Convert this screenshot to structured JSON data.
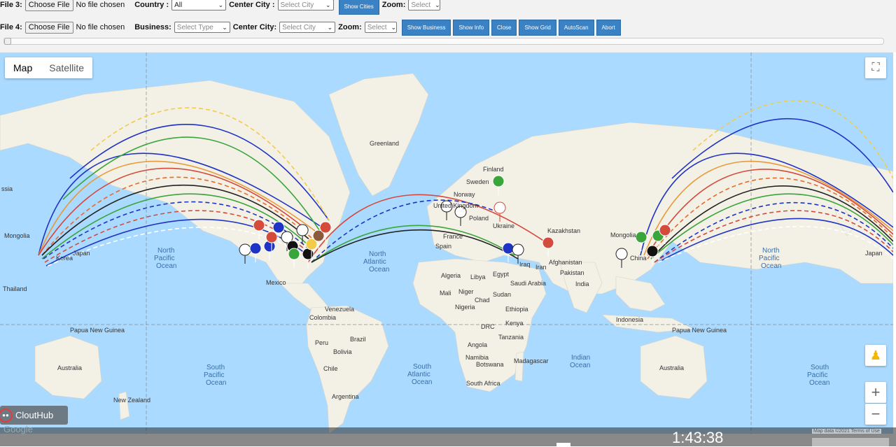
{
  "toolbar": {
    "row1": {
      "file_label": "File 3:",
      "choose_file": "Choose File",
      "no_file": "No file chosen",
      "country_label": "Country :",
      "country_value": "All",
      "center_city_label": "Center City :",
      "center_city_value": "Select City",
      "show_cities": "Show Cities",
      "zoom_label": "Zoom:",
      "zoom_value": "Select"
    },
    "row2": {
      "file_label": "File 4:",
      "choose_file": "Choose File",
      "no_file": "No file chosen",
      "business_label": "Business:",
      "business_value": "Select Type",
      "center_city_label": "Center City:",
      "center_city_value": "Select City",
      "zoom_label": "Zoom:",
      "zoom_value": "Select",
      "buttons": [
        "Show Business",
        "Show Info",
        "Close",
        "Show Grid",
        "AutoScan",
        "Abort"
      ]
    }
  },
  "map": {
    "type_map": "Map",
    "type_satellite": "Satellite",
    "labels": {
      "greenland": "Greenland",
      "finland": "Finland",
      "sweden": "Sweden",
      "norway": "Norway",
      "kazakhstan": "Kazakhstan",
      "mongolia_r": "Mongolia",
      "mongolia_l": "Mongolia",
      "japan_l": "Japan",
      "korea_l": "Korea",
      "thailand": "Thailand",
      "japan_r": "Japan",
      "china": "China",
      "india": "India",
      "iran": "Iran",
      "iraq": "Iraq",
      "afghanistan": "Afghanistan",
      "pakistan": "Pakistan",
      "mexico": "Mexico",
      "venezuela": "Venezuela",
      "colombia": "Colombia",
      "peru": "Peru",
      "bolivia": "Bolivia",
      "brazil": "Brazil",
      "chile": "Chile",
      "argentina": "Argentina",
      "algeria": "Algeria",
      "libya": "Libya",
      "egypt": "Egypt",
      "mali": "Mali",
      "niger": "Niger",
      "chad": "Chad",
      "sudan": "Sudan",
      "nigeria": "Nigeria",
      "ethiopia": "Ethiopia",
      "kenya": "Kenya",
      "drc": "DRC",
      "tanzania": "Tanzania",
      "angola": "Angola",
      "namibia": "Namibia",
      "botswana": "Botswana",
      "south_africa": "South Africa",
      "madagascar": "Madagascar",
      "saudi_arabia": "Saudi Arabia",
      "spain": "Spain",
      "france": "France",
      "uk": "United Kingdom",
      "poland": "Poland",
      "ukraine": "Ukraine",
      "australia_l": "Australia",
      "australia_r": "Australia",
      "new_zealand": "New Zealand",
      "png_l": "Papua New Guinea",
      "png_r": "Papua New Guinea",
      "indonesia": "Indonesia"
    },
    "oceans": {
      "np_l1": "North",
      "np_l2": "Pacific",
      "np_l3": "Ocean",
      "na1": "North",
      "na2": "Atlantic",
      "na3": "Ocean",
      "sp_l1": "South",
      "sp_l2": "Pacific",
      "sp_l3": "Ocean",
      "sa1": "South",
      "sa2": "Atlantic",
      "sa3": "Ocean",
      "io1": "Indian",
      "io2": "Ocean",
      "np_r1": "North",
      "np_r2": "Pacific",
      "np_r3": "Ocean",
      "sp_r1": "South",
      "sp_r2": "Pacific",
      "sp_r3": "Ocean"
    },
    "edge_labels": {
      "ssia": "ssia",
      "mongolia_edge": "Mongolia"
    },
    "zoom_in": "+",
    "zoom_out": "−",
    "google": "Google",
    "map_data": "Map data ©2021   Terms of Use"
  },
  "overlay": {
    "clouthub": "CloutHub",
    "time": "1:43:38"
  },
  "colors": {
    "ocean": "#aadaff",
    "land": "#f3f0e6",
    "button": "#3b82c4"
  }
}
